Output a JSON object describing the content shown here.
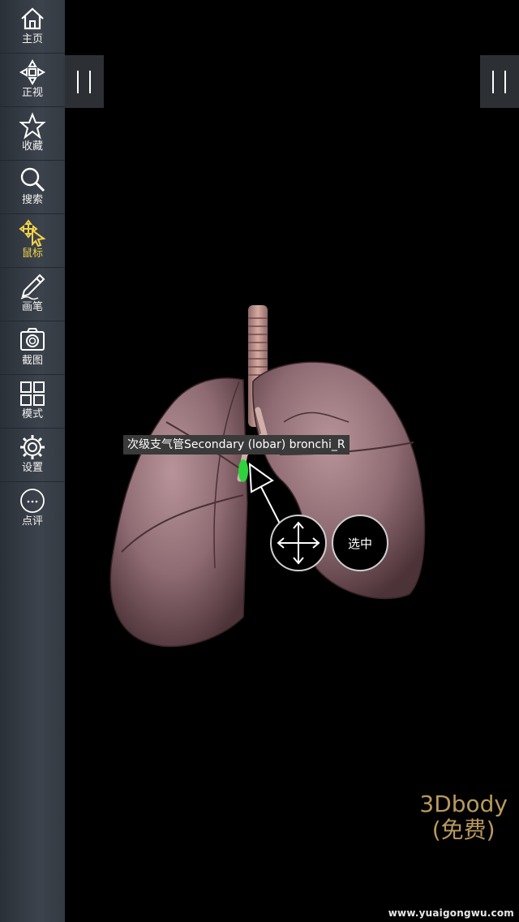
{
  "sidebar": {
    "items": [
      {
        "label": "主页",
        "icon": "home-icon"
      },
      {
        "label": "正视",
        "icon": "front-view-icon"
      },
      {
        "label": "收藏",
        "icon": "star-icon"
      },
      {
        "label": "搜索",
        "icon": "search-icon"
      },
      {
        "label": "鼠标",
        "icon": "pointer-move-icon",
        "active": true
      },
      {
        "label": "画笔",
        "icon": "pen-icon"
      },
      {
        "label": "截图",
        "icon": "camera-icon"
      },
      {
        "label": "模式",
        "icon": "grid-mode-icon"
      },
      {
        "label": "设置",
        "icon": "gear-icon"
      },
      {
        "label": "点评",
        "icon": "comment-icon"
      }
    ]
  },
  "viewer": {
    "tooltip": "次级支气管Secondary (lobar) bronchi_R",
    "select_label": "选中",
    "brand_line1": "3Dbody",
    "brand_line2": "(免费)",
    "watermark": "www.yuaigongwu.com"
  },
  "colors": {
    "active": "#f3d24a",
    "brand": "#b89a5c",
    "highlight": "#2fd23a"
  }
}
